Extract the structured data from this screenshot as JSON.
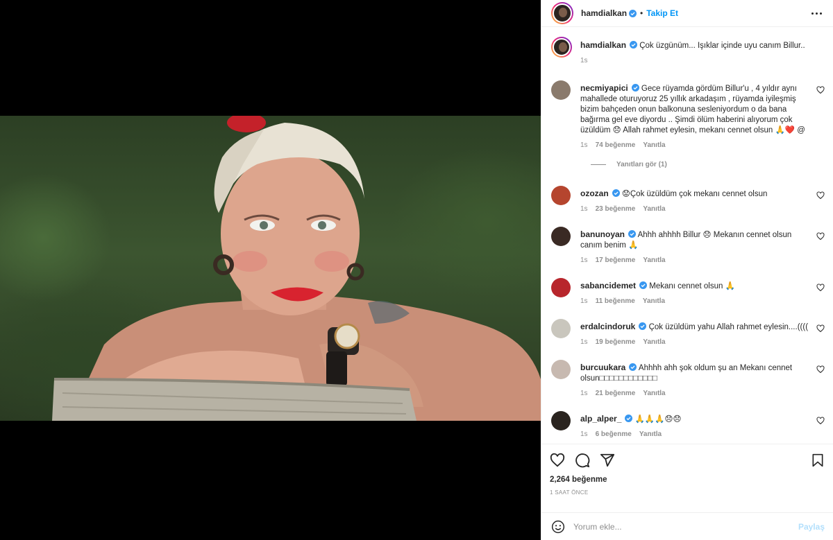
{
  "header": {
    "username": "hamdialkan",
    "separator": "•",
    "follow_label": "Takip Et"
  },
  "caption": {
    "username": "hamdialkan",
    "text": "Çok üzgünüm... Işıklar içinde uyu canım Billur..",
    "time": "1s"
  },
  "comments": [
    {
      "username": "necmiyapici",
      "text": "Gece rüyamda gördüm Billur'u , 4 yıldır aynı mahallede oturuyoruz 25 yıllık arkadaşım , rüyamda iyileşmiş bizim bahçeden onun balkonuna sesleniyordum o da bana bağırma gel eve diyordu .. Şimdi ölüm haberini alıyorum çok üzüldüm 😞 Allah rahmet eylesin, mekanı cennet olsun 🙏❤️ @",
      "time": "1s",
      "likes": "74 beğenme",
      "reply": "Yanıtla",
      "view_replies": "Yanıtları gör (1)",
      "avatar_color": "#8a7a6c"
    },
    {
      "username": "ozozan",
      "text": "😟Çok üzüldüm çok mekanı cennet olsun",
      "time": "1s",
      "likes": "23 beğenme",
      "reply": "Yanıtla",
      "avatar_color": "#b5452e"
    },
    {
      "username": "banunoyan",
      "text": "Ahhh ahhhh Billur 😞 Mekanın cennet olsun canım benim 🙏",
      "time": "1s",
      "likes": "17 beğenme",
      "reply": "Yanıtla",
      "avatar_color": "#3a2a24"
    },
    {
      "username": "sabancidemet",
      "text": "Mekanı cennet olsun 🙏",
      "time": "1s",
      "likes": "11 beğenme",
      "reply": "Yanıtla",
      "avatar_color": "#b8262c"
    },
    {
      "username": "erdalcindoruk",
      "text": "Çok üzüldüm yahu Allah rahmet eylesin....((((",
      "time": "1s",
      "likes": "19 beğenme",
      "reply": "Yanıtla",
      "avatar_color": "#c9c6bd"
    },
    {
      "username": "burcuukara",
      "text": "Ahhhh ahh şok oldum şu an Mekanı cennet olsun□□□□□□□□□□□□",
      "time": "1s",
      "likes": "21 beğenme",
      "reply": "Yanıtla",
      "avatar_color": "#c7b9b0"
    },
    {
      "username": "alp_alper_",
      "text": "🙏🙏🙏😞😞",
      "time": "1s",
      "likes": "6 beğenme",
      "reply": "Yanıtla",
      "avatar_color": "#2a241f"
    }
  ],
  "footer": {
    "likes": "2,264 beğenme",
    "time_ago": "1 SAAT ÖNCE",
    "comment_placeholder": "Yorum ekle...",
    "post_label": "Paylaş"
  },
  "icons": {
    "like": "heart-icon",
    "comment": "comment-icon",
    "share": "share-icon",
    "save": "bookmark-icon",
    "emoji": "emoji-icon",
    "verified": "verified-badge-icon",
    "more": "more-options-icon"
  },
  "colors": {
    "accent": "#0095f6",
    "verified": "#3897f0",
    "muted": "#8e8e8e",
    "post_disabled": "#b2dffc"
  }
}
